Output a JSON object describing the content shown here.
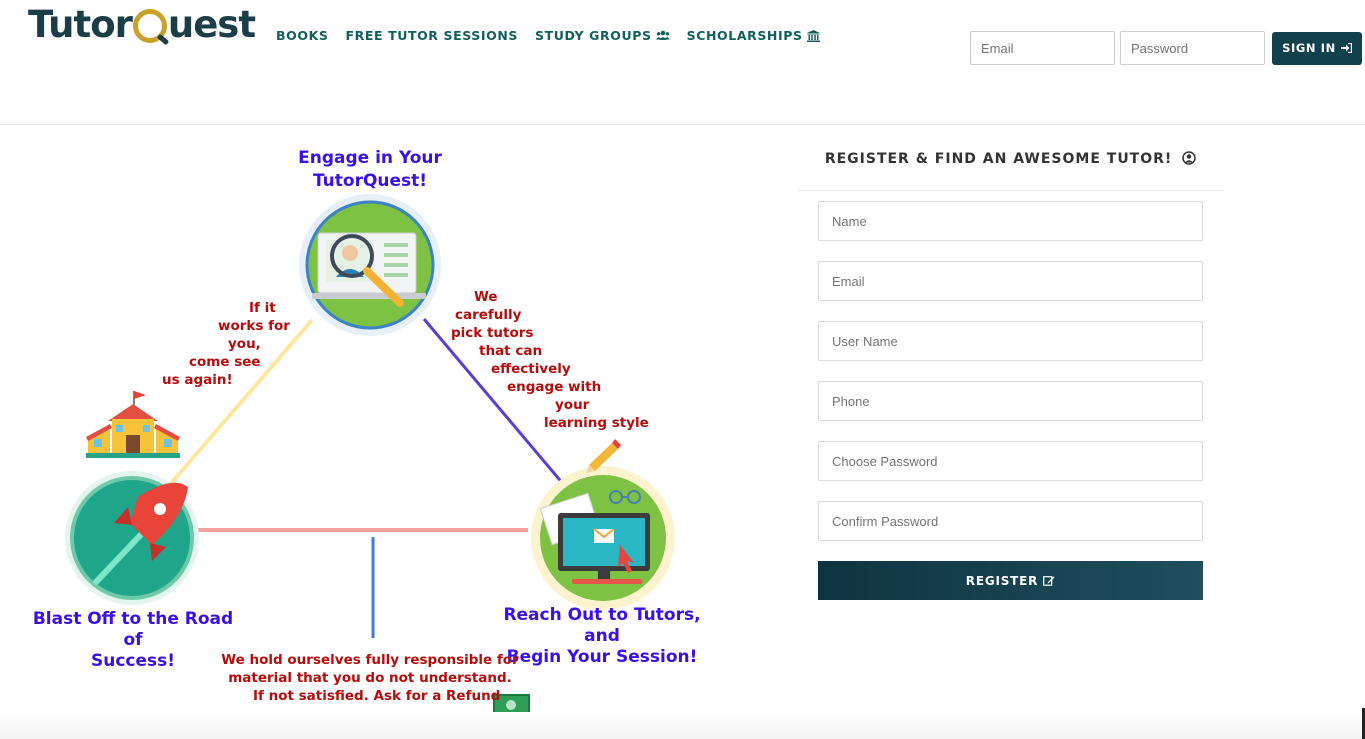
{
  "header": {
    "logo_text_a": "Tutor",
    "logo_text_b": "uest",
    "nav": [
      {
        "label": "BOOKS"
      },
      {
        "label": "FREE TUTOR SESSIONS"
      },
      {
        "label": "STUDY GROUPS",
        "icon": "users-icon"
      },
      {
        "label": "SCHOLARSHIPS",
        "icon": "institution-icon"
      }
    ],
    "login": {
      "email_placeholder": "Email",
      "password_placeholder": "Password",
      "signin_label": "SIGN IN",
      "signin_icon": "sign-in-icon"
    }
  },
  "graphic": {
    "engage_title_line1": "Engage in Your",
    "engage_title_line2": "TutorQuest!",
    "blast_line1": "Blast Off to the Road of",
    "blast_line2": "Success!",
    "reach_line1": "Reach Out to Tutors, and",
    "reach_line2": "Begin Your Session!",
    "left_note": [
      "If it",
      "works for",
      "you,",
      "come see",
      "us again!"
    ],
    "right_note": [
      "We",
      "carefully",
      "pick tutors",
      "that can",
      "effectively",
      "engage with",
      "your",
      "learning style"
    ],
    "bottom_note": [
      "We hold ourselves fully responsible for",
      "material that you do not understand.",
      "If not satisfied. Ask for a Refund"
    ],
    "colors": {
      "blue_text": "#3a10e6",
      "red_text": "#b50d0d",
      "green_circle": "#7dc242",
      "teal_circle": "#1fa589"
    }
  },
  "register": {
    "title": "REGISTER & FIND AN AWESOME TUTOR!",
    "title_icon": "user-circle-icon",
    "fields": {
      "name": "Name",
      "email": "Email",
      "username": "User Name",
      "phone": "Phone",
      "password": "Choose Password",
      "confirm": "Confirm Password"
    },
    "button_label": "REGISTER",
    "button_icon": "edit-icon"
  },
  "colors": {
    "accent_dark": "#12414e",
    "nav_teal": "#12605c"
  }
}
